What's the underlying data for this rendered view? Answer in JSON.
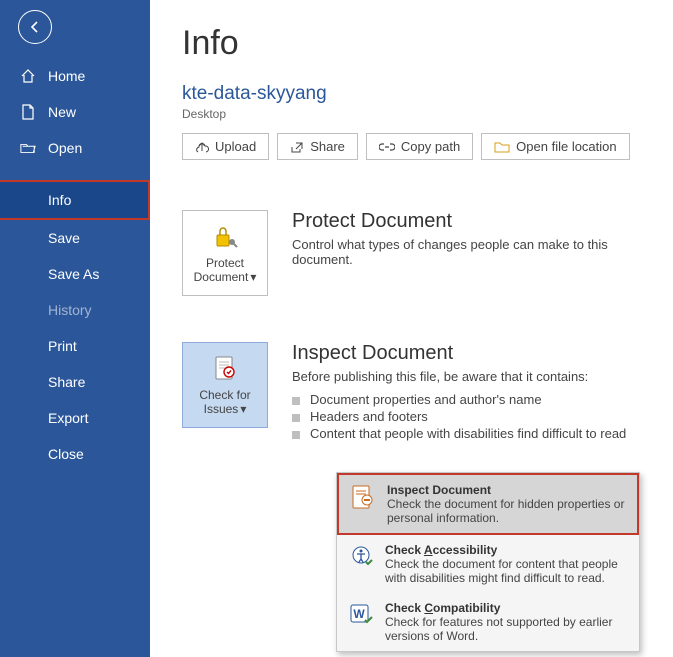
{
  "sidebar": {
    "items": [
      {
        "label": "Home"
      },
      {
        "label": "New"
      },
      {
        "label": "Open"
      },
      {
        "label": "Info"
      },
      {
        "label": "Save"
      },
      {
        "label": "Save As"
      },
      {
        "label": "History"
      },
      {
        "label": "Print"
      },
      {
        "label": "Share"
      },
      {
        "label": "Export"
      },
      {
        "label": "Close"
      }
    ]
  },
  "main": {
    "title": "Info",
    "doc_name": "kte-data-skyyang",
    "doc_path": "Desktop",
    "buttons": {
      "upload": "Upload",
      "share": "Share",
      "copy_path": "Copy path",
      "open_loc": "Open file location"
    },
    "protect": {
      "btn_line1": "Protect",
      "btn_line2": "Document",
      "heading": "Protect Document",
      "sub": "Control what types of changes people can make to this document."
    },
    "inspect": {
      "btn_line1": "Check for",
      "btn_line2": "Issues",
      "heading": "Inspect Document",
      "sub": "Before publishing this file, be aware that it contains:",
      "bullets": [
        "Document properties and author's name",
        "Headers and footers",
        "Content that people with disabilities find difficult to read"
      ]
    }
  },
  "popup": {
    "items": [
      {
        "title": "Inspect Document",
        "desc": "Check the document for hidden properties or personal information."
      },
      {
        "title": "Check Accessibility",
        "desc": "Check the document for content that people with disabilities might find difficult to read."
      },
      {
        "title": "Check Compatibility",
        "desc": "Check for features not supported by earlier versions of Word."
      }
    ]
  }
}
